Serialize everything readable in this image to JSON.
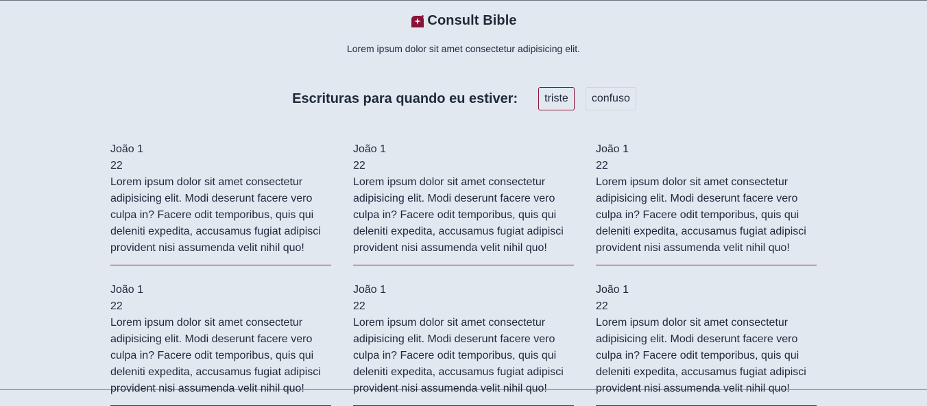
{
  "brand": {
    "title": "Consult Bible",
    "icon": "bible-logo-icon",
    "accent_color": "#881337"
  },
  "tagline": "Lorem ipsum dolor sit amet consectetur adipisicing elit.",
  "filter": {
    "label": "Escrituras para quando eu estiver:",
    "options": [
      {
        "label": "triste",
        "active": true
      },
      {
        "label": "confuso",
        "active": false
      }
    ]
  },
  "verses": [
    {
      "book": "João 1",
      "verse": "22",
      "text": "Lorem ipsum dolor sit amet consectetur adipisicing elit. Modi deserunt facere vero culpa in? Facere odit temporibus, quis qui deleniti expedita, accusamus fugiat adipisci provident nisi assumenda velit nihil quo!"
    },
    {
      "book": "João 1",
      "verse": "22",
      "text": "Lorem ipsum dolor sit amet consectetur adipisicing elit. Modi deserunt facere vero culpa in? Facere odit temporibus, quis qui deleniti expedita, accusamus fugiat adipisci provident nisi assumenda velit nihil quo!"
    },
    {
      "book": "João 1",
      "verse": "22",
      "text": "Lorem ipsum dolor sit amet consectetur adipisicing elit. Modi deserunt facere vero culpa in? Facere odit temporibus, quis qui deleniti expedita, accusamus fugiat adipisci provident nisi assumenda velit nihil quo!"
    },
    {
      "book": "João 1",
      "verse": "22",
      "text": "Lorem ipsum dolor sit amet consectetur adipisicing elit. Modi deserunt facere vero culpa in? Facere odit temporibus, quis qui deleniti expedita, accusamus fugiat adipisci provident nisi assumenda velit nihil quo!"
    },
    {
      "book": "João 1",
      "verse": "22",
      "text": "Lorem ipsum dolor sit amet consectetur adipisicing elit. Modi deserunt facere vero culpa in? Facere odit temporibus, quis qui deleniti expedita, accusamus fugiat adipisci provident nisi assumenda velit nihil quo!"
    },
    {
      "book": "João 1",
      "verse": "22",
      "text": "Lorem ipsum dolor sit amet consectetur adipisicing elit. Modi deserunt facere vero culpa in? Facere odit temporibus, quis qui deleniti expedita, accusamus fugiat adipisci provident nisi assumenda velit nihil quo!"
    }
  ]
}
